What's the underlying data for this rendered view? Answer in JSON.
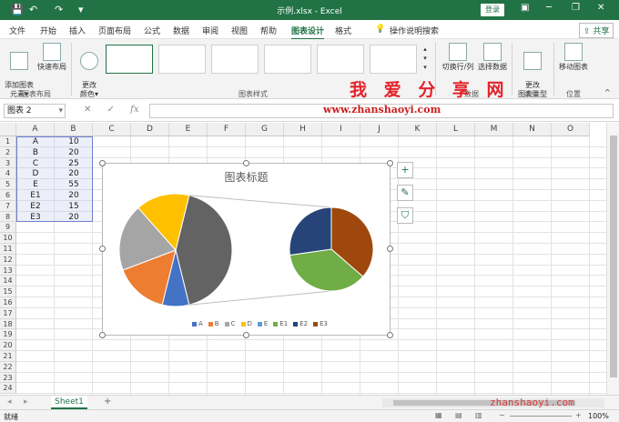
{
  "titlebar": {
    "doc_title": "示例.xlsx  -  Excel",
    "login": "登录",
    "minimize": "─",
    "restore": "❐",
    "close": "✕"
  },
  "menu": {
    "tabs": [
      "文件",
      "开始",
      "插入",
      "页面布局",
      "公式",
      "数据",
      "审阅",
      "视图",
      "帮助",
      "图表设计",
      "格式"
    ],
    "active_tab": "图表设计",
    "tell_me": "操作说明搜索",
    "share": "共享"
  },
  "ribbon": {
    "add_element": "添加图表\n元素▾",
    "quick_layout": "快速布局",
    "layout_group": "图表布局",
    "change_colors": "更改\n颜色▾",
    "styles_group": "图表样式",
    "switch_row_col": "切换行/列",
    "select_data": "选择数据",
    "data_group": "数据",
    "change_type": "更改\n图表类型",
    "type_group": "类型",
    "move_chart": "移动图表",
    "location_group": "位置"
  },
  "formula_bar": {
    "name_box": "图表 2",
    "fx": "fx",
    "cancel": "✕",
    "enter": "✓",
    "value": ""
  },
  "watermark": {
    "text_cn": "我 爱 分 享 网",
    "url": "www.zhanshaoyi.com",
    "bottom_url": "zhanshaoyi.com"
  },
  "sheet": {
    "columns": [
      "A",
      "B",
      "C",
      "D",
      "E",
      "F",
      "G",
      "H",
      "I",
      "J",
      "K",
      "L",
      "M",
      "N",
      "O"
    ],
    "rows": [
      "1",
      "2",
      "3",
      "4",
      "5",
      "6",
      "7",
      "8",
      "9",
      "10",
      "11",
      "12",
      "13",
      "14",
      "15",
      "16",
      "17",
      "18",
      "19",
      "20",
      "21",
      "22",
      "23",
      "24"
    ],
    "data": [
      {
        "a": "A",
        "b": "10"
      },
      {
        "a": "B",
        "b": "20"
      },
      {
        "a": "C",
        "b": "25"
      },
      {
        "a": "D",
        "b": "20"
      },
      {
        "a": "E",
        "b": "55"
      },
      {
        "a": "E1",
        "b": "20"
      },
      {
        "a": "E2",
        "b": "15"
      },
      {
        "a": "E3",
        "b": "20"
      }
    ],
    "tab_name": "Sheet1",
    "add_sheet": "+"
  },
  "chart_data": {
    "type": "pie",
    "title": "图表标题",
    "categories": [
      "A",
      "B",
      "C",
      "D",
      "E1",
      "E2",
      "E3"
    ],
    "secondary_categories": [
      "E1",
      "E2",
      "E3"
    ],
    "values": [
      10,
      20,
      25,
      20,
      20,
      15,
      20
    ],
    "subtype": "pie-of-pie",
    "colors": [
      "#4472c4",
      "#ed7d31",
      "#a5a5a5",
      "#ffc000",
      "#5b9bd5",
      "#70ad47",
      "#264478",
      "#9e480e"
    ],
    "legend_position": "bottom",
    "legend": [
      {
        "name": "A",
        "color": "#4472c4"
      },
      {
        "name": "B",
        "color": "#ed7d31"
      },
      {
        "name": "C",
        "color": "#a5a5a5"
      },
      {
        "name": "D",
        "color": "#ffc000"
      },
      {
        "name": "E",
        "color": "#5b9bd5"
      },
      {
        "name": "E1",
        "color": "#70ad47"
      },
      {
        "name": "E2",
        "color": "#264478"
      },
      {
        "name": "E3",
        "color": "#9e480e"
      }
    ]
  },
  "statusbar": {
    "status": "就绪",
    "zoom": "100%"
  },
  "colors": {
    "brand": "#217346",
    "watermark_red": "#e3232a"
  }
}
